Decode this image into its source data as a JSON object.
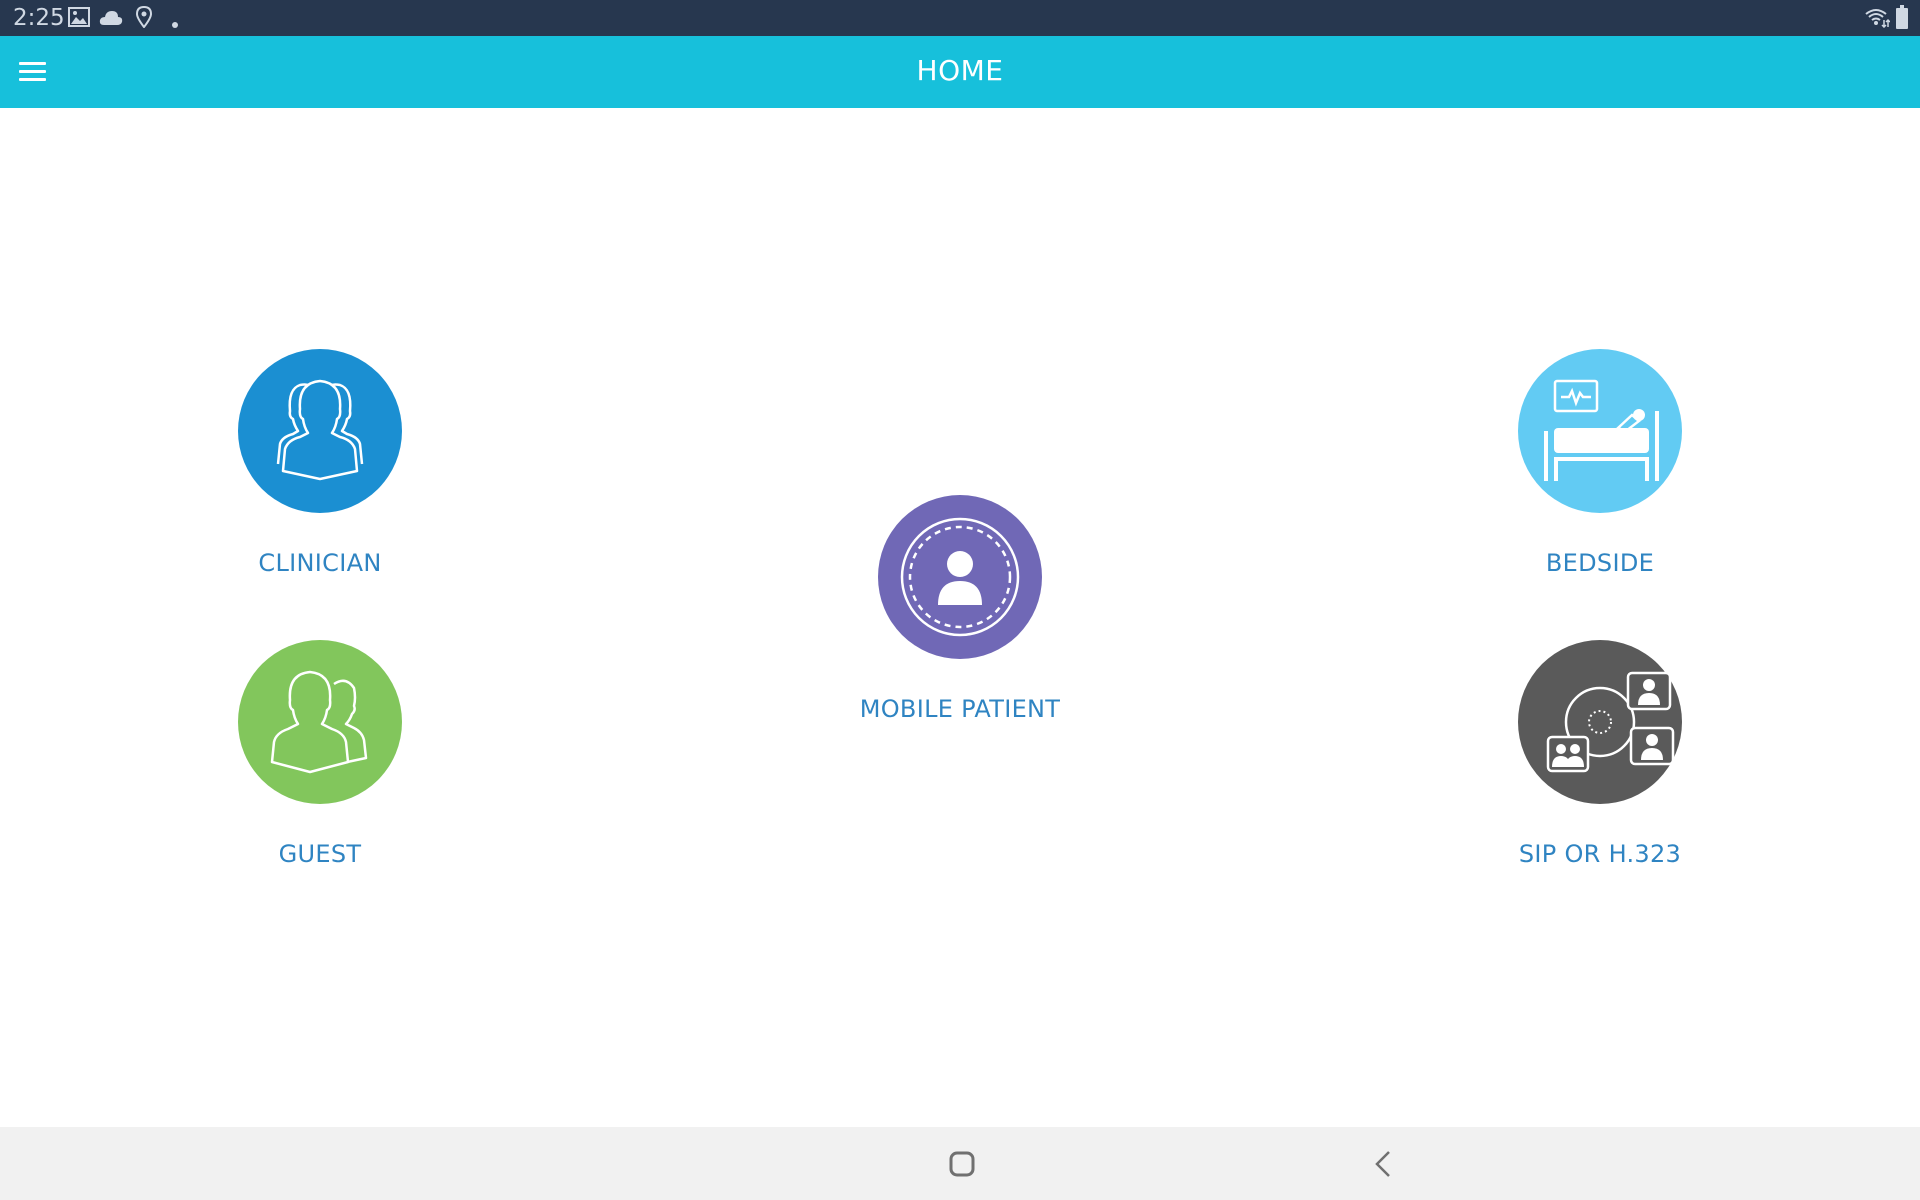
{
  "status_bar": {
    "time": "2:25",
    "left_icons": [
      "image-icon",
      "cloud-icon",
      "location-pin-icon",
      "notification-dot-icon"
    ],
    "right_icons": [
      "wifi-icon",
      "battery-icon"
    ],
    "background": "#27374f"
  },
  "app_bar": {
    "title": "HOME",
    "menu_icon": "hamburger-menu-icon",
    "background": "#17c0db"
  },
  "tiles": [
    {
      "id": "clinician",
      "label": "CLINICIAN",
      "icon": "group-people-icon",
      "color": "#1b8fd2"
    },
    {
      "id": "guest",
      "label": "GUEST",
      "icon": "two-people-icon",
      "color": "#82c65c"
    },
    {
      "id": "mobile_patient",
      "label": "MOBILE PATIENT",
      "icon": "patient-person-icon",
      "color": "#7068b6"
    },
    {
      "id": "bedside",
      "label": "BEDSIDE",
      "icon": "hospital-bed-monitor-icon",
      "color": "#62cbf3"
    },
    {
      "id": "sip",
      "label": "SIP OR H.323",
      "icon": "video-conference-network-icon",
      "color": "#5a5a5a"
    }
  ],
  "label_color": "#2f84c2",
  "nav_bar": {
    "buttons": [
      "home-button",
      "back-button"
    ],
    "background": "#f1f1f1"
  }
}
